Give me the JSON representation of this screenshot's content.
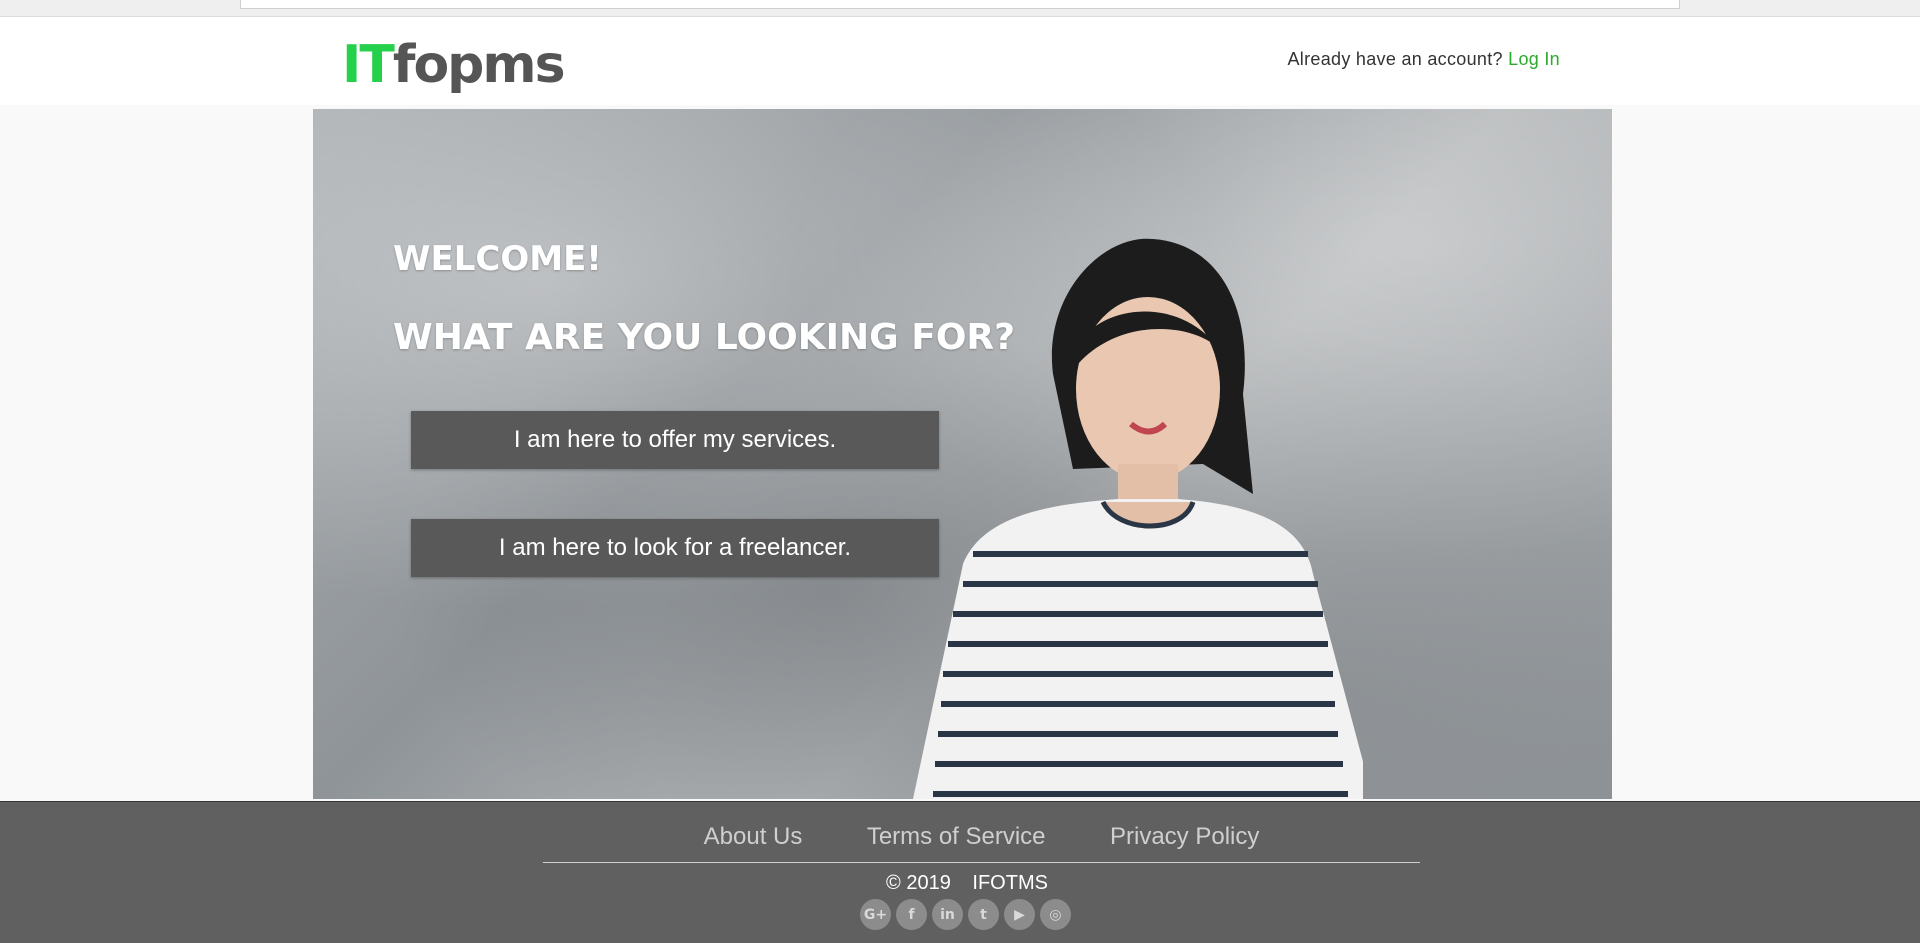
{
  "header": {
    "logo_part1": "IT",
    "logo_part2": "fopms",
    "account_prompt": "Already have an account?",
    "login_label": "Log In"
  },
  "hero": {
    "welcome": "WELCOME!",
    "question": "WHAT ARE YOU LOOKING FOR?",
    "offer_button": "I am here to offer my services.",
    "hire_button": "I am here to look for a freelancer."
  },
  "footer": {
    "links": [
      "About Us",
      "Terms of Service",
      "Privacy Policy"
    ],
    "copyright": "© 2019",
    "brand": "IFOTMS",
    "social": [
      {
        "name": "google-plus-icon",
        "glyph": "G+"
      },
      {
        "name": "facebook-icon",
        "glyph": "f"
      },
      {
        "name": "linkedin-icon",
        "glyph": "in"
      },
      {
        "name": "twitter-icon",
        "glyph": "t"
      },
      {
        "name": "youtube-icon",
        "glyph": "▶"
      },
      {
        "name": "instagram-icon",
        "glyph": "◎"
      }
    ]
  },
  "colors": {
    "brand_green": "#25d04b",
    "login_green": "#2bab2b",
    "button_gray": "#595959",
    "footer_gray": "#606060"
  }
}
